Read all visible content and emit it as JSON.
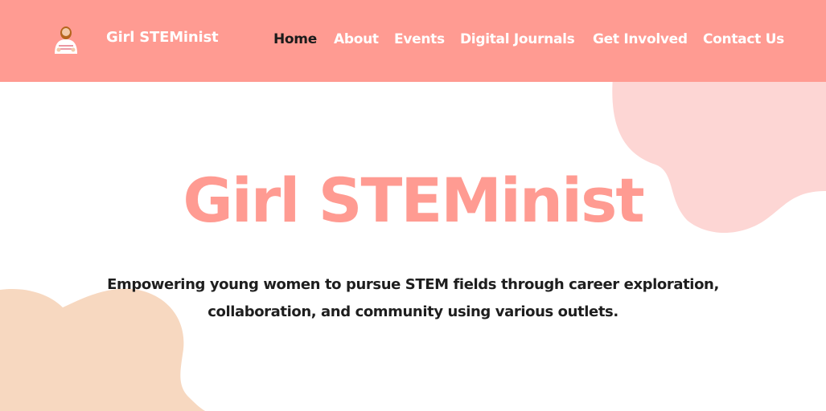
{
  "header": {
    "brand": "Girl STEMinist",
    "logo_icon": "girl-steminist-logo-icon",
    "background_color": "#ff9b92"
  },
  "nav": {
    "items": [
      {
        "label": "Home",
        "active": true
      },
      {
        "label": "About",
        "active": false
      },
      {
        "label": "Events",
        "active": false
      },
      {
        "label": "Digital Journals",
        "active": false
      },
      {
        "label": "Get Involved",
        "active": false
      },
      {
        "label": "Contact Us",
        "active": false
      }
    ]
  },
  "hero": {
    "title": "Girl STEMinist",
    "tagline_line1": "Empowering young women to pursue STEM fields through career exploration,",
    "tagline_line2": "collaboration, and community using various outlets."
  },
  "colors": {
    "accent": "#ff9b92",
    "blob_pink": "#fdd6d4",
    "blob_peach": "#f7d8c0",
    "text_dark": "#1e1e1e"
  }
}
